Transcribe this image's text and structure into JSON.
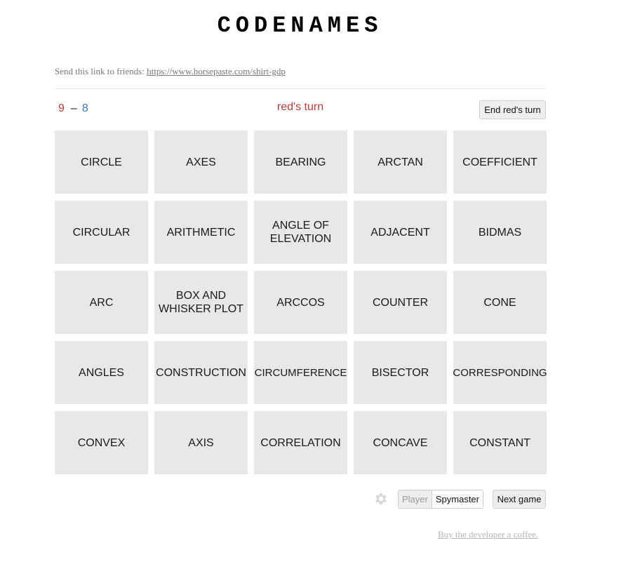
{
  "title": "CODENAMES",
  "share": {
    "text": "Send this link to friends: ",
    "link": "https://www.horsepaste.com/shirt-gdp"
  },
  "score": {
    "red": "9",
    "separator": "–",
    "blue": "8"
  },
  "turn_label": "red's turn",
  "end_turn_label": "End red's turn",
  "cards": [
    [
      "CIRCLE",
      "AXES",
      "BEARING",
      "ARCTAN",
      "COEFFICIENT"
    ],
    [
      "CIRCULAR",
      "ARITHMETIC",
      "ANGLE OF ELEVATION",
      "ADJACENT",
      "BIDMAS"
    ],
    [
      "ARC",
      "BOX AND WHISKER PLOT",
      "ARCCOS",
      "COUNTER",
      "CONE"
    ],
    [
      "ANGLES",
      "CONSTRUCTION",
      "CIRCUMFERENCE",
      "BISECTOR",
      "CORRESPONDING"
    ],
    [
      "CONVEX",
      "AXIS",
      "CORRELATION",
      "CONCAVE",
      "CONSTANT"
    ]
  ],
  "controls": {
    "settings_icon": "gear-icon",
    "player_label": "Player",
    "spymaster_label": "Spymaster",
    "selected_role": "Spymaster",
    "next_game_label": "Next game"
  },
  "footer": {
    "coffee_link": "Buy the developer a coffee."
  },
  "colors": {
    "red_team": "#c13a3a",
    "blue_team": "#3b78c2",
    "card_bg": "#e8e8e8"
  }
}
